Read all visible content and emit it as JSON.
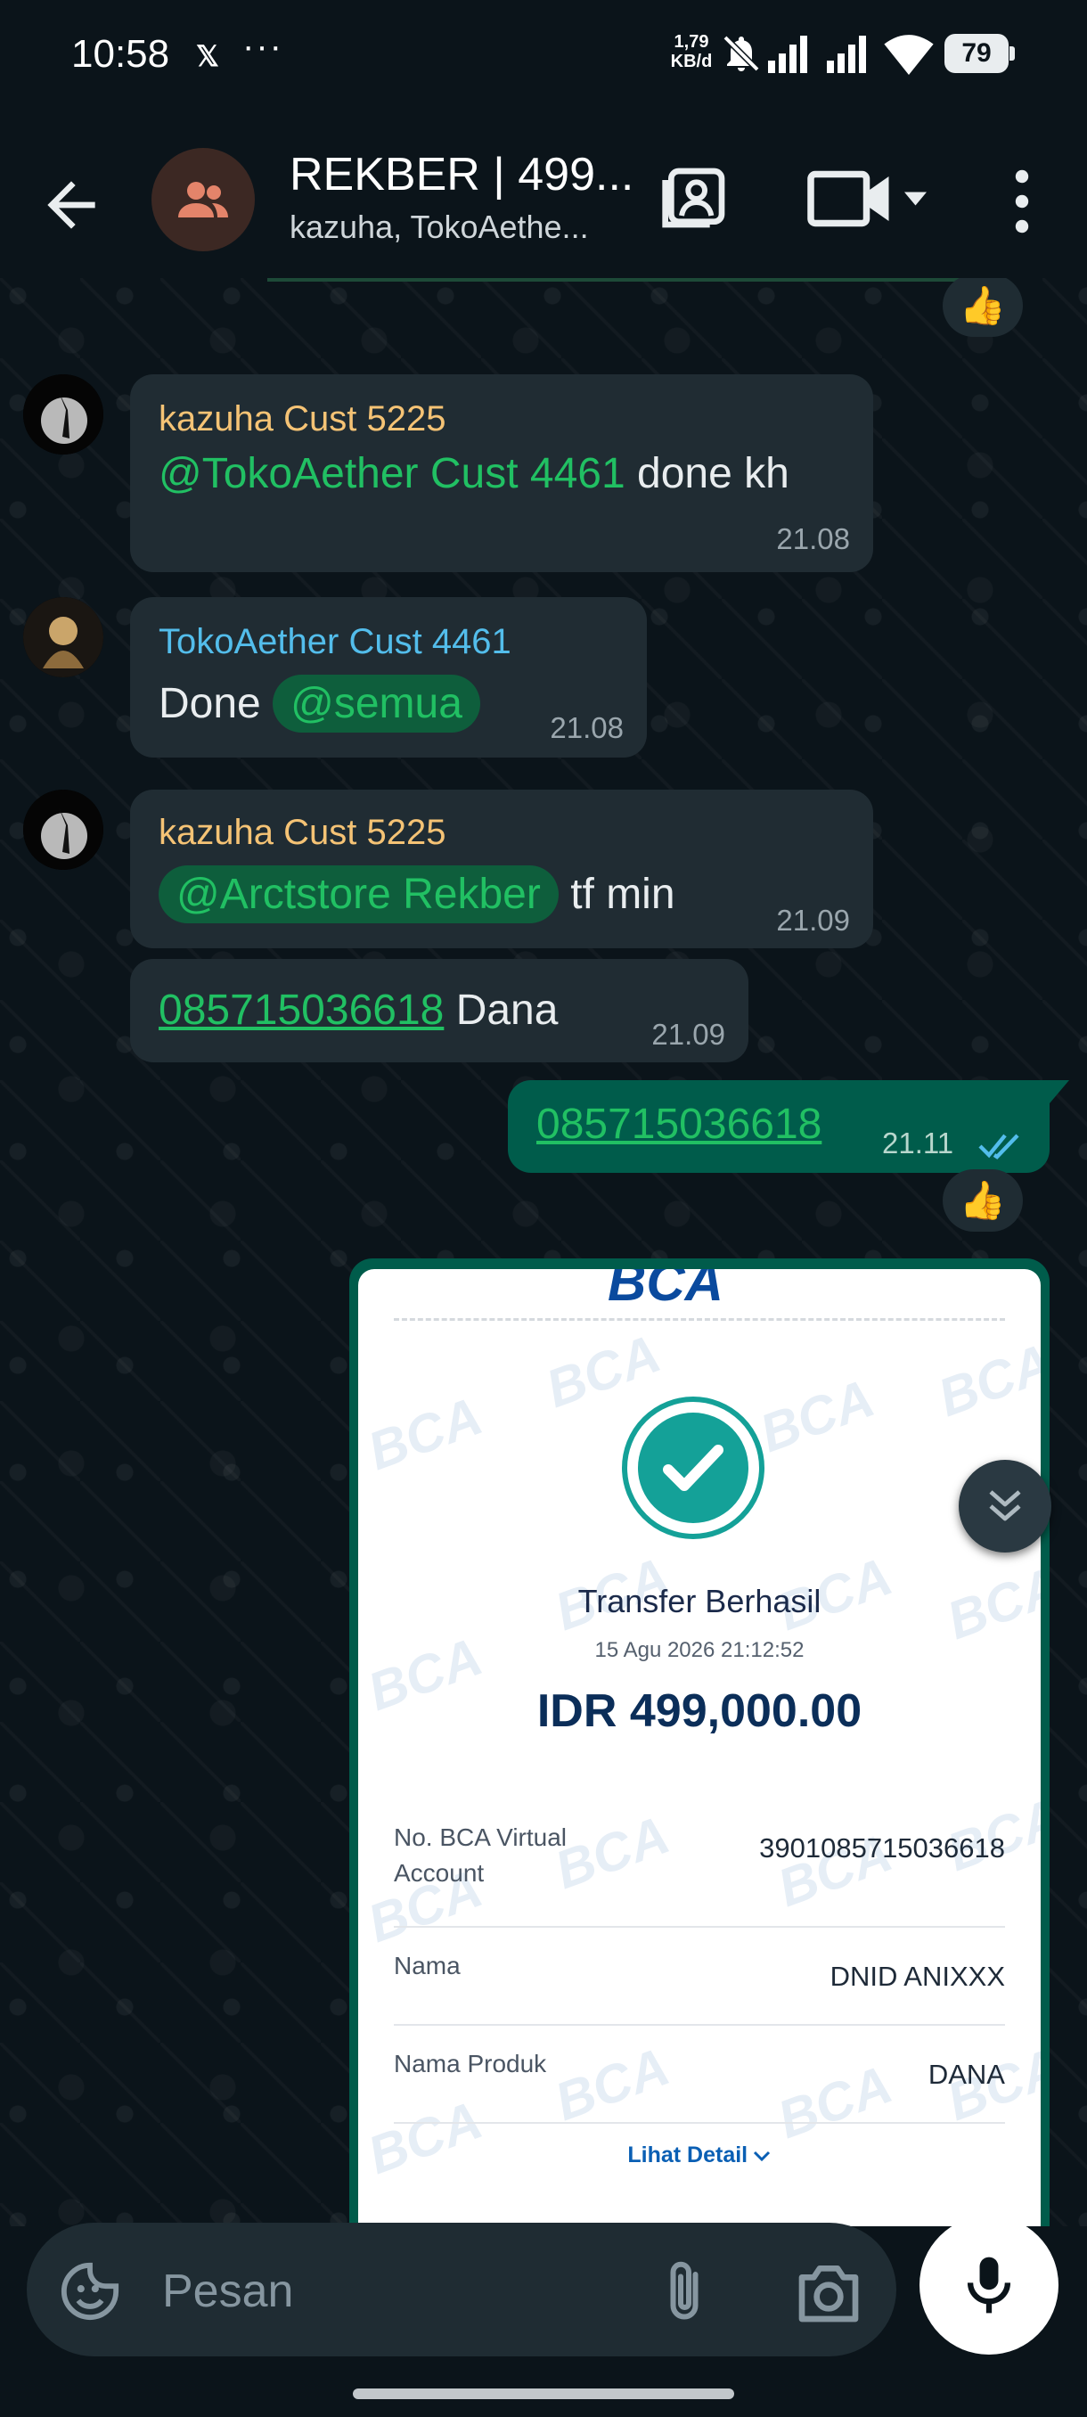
{
  "status_bar": {
    "time": "10:58",
    "x_icon": "𝕏",
    "more": "···",
    "net_speed_value": "1,79",
    "net_speed_unit": "KB/d",
    "battery": "79"
  },
  "header": {
    "title": "REKBER | 499...",
    "subtitle": "kazuha, TokoAethe..."
  },
  "messages": [
    {
      "sender": "kazuha Cust 5225",
      "mention": "@TokoAether Cust 4461",
      "text": "done kh",
      "time": "21.08"
    },
    {
      "sender": "TokoAether Cust 4461",
      "text": "Done",
      "mention": "@semua",
      "time": "21.08"
    },
    {
      "sender": "kazuha Cust 5225",
      "mention": "@Arctstore Rekber",
      "text": "tf min",
      "time": "21.09"
    },
    {
      "link": "085715036618",
      "text": "Dana",
      "time": "21.09"
    }
  ],
  "outgoing": {
    "link": "085715036618",
    "time": "21.11",
    "status": "read"
  },
  "reactions": [
    "👍",
    "👍"
  ],
  "receipt": {
    "bank": "BCA",
    "watermark": "BCA",
    "status": "Transfer Berhasil",
    "datetime": "15 Agu 2026 21:12:52",
    "amount": "IDR 499,000.00",
    "rows": [
      {
        "label": "No. BCA Virtual Account",
        "value": "3901085715036618"
      },
      {
        "label": "Nama",
        "value": "DNID ANIXXX"
      },
      {
        "label": "Nama Produk",
        "value": "DANA"
      }
    ],
    "detail_link": "Lihat Detail"
  },
  "input": {
    "placeholder": "Pesan"
  },
  "colors": {
    "background": "#0b141a",
    "incoming_bubble": "#202c33",
    "outgoing_bubble": "#005c4b",
    "mention": "#21c063",
    "sender_yellow": "#f5c375",
    "sender_blue": "#53bdeb",
    "read_ticks": "#53bdeb"
  },
  "icons": [
    "back-arrow-icon",
    "group-icon",
    "status-icon",
    "video-call-icon",
    "dropdown-icon",
    "more-vert-icon",
    "sticker-icon",
    "paperclip-icon",
    "camera-icon",
    "mic-icon",
    "double-chevron-down-icon",
    "double-check-icon"
  ]
}
